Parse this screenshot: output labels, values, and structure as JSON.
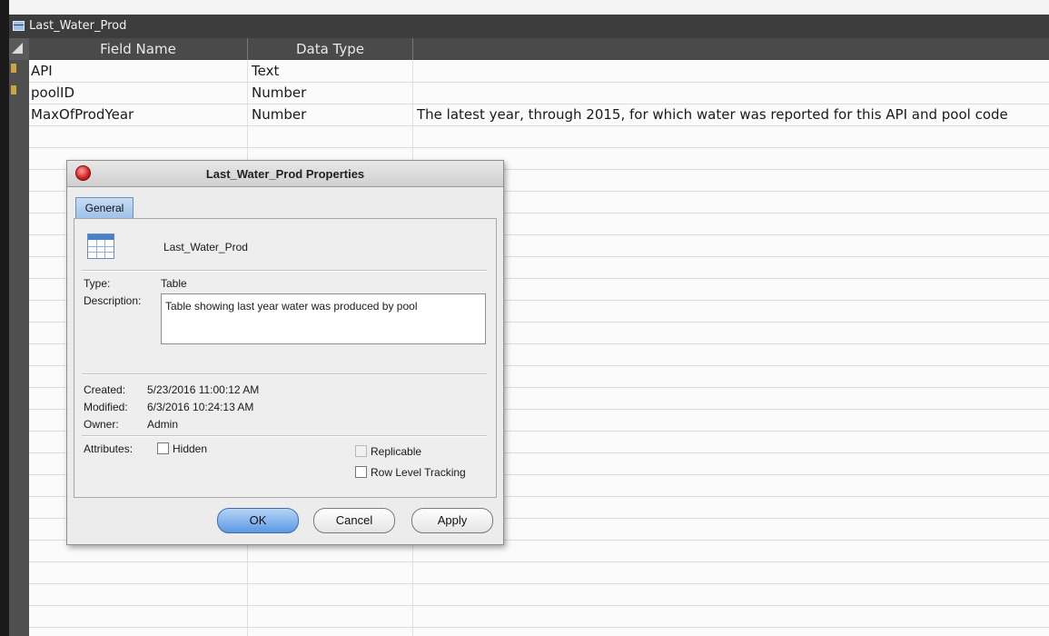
{
  "window": {
    "title": "Last_Water_Prod"
  },
  "columns": {
    "field_name": "Field Name",
    "data_type": "Data Type"
  },
  "rows": [
    {
      "field": "API",
      "type": "Text",
      "description": ""
    },
    {
      "field": "poolID",
      "type": "Number",
      "description": ""
    },
    {
      "field": "MaxOfProdYear",
      "type": "Number",
      "description": "The latest year, through 2015, for which water was reported for this API and pool code"
    }
  ],
  "dialog": {
    "title": "Last_Water_Prod Properties",
    "tab": "General",
    "object_name": "Last_Water_Prod",
    "type_label": "Type:",
    "type_value": "Table",
    "description_label": "Description:",
    "description_value": "Table showing last year water was produced by pool",
    "created_label": "Created:",
    "created_value": "5/23/2016 11:00:12 AM",
    "modified_label": "Modified:",
    "modified_value": "6/3/2016 10:24:13 AM",
    "owner_label": "Owner:",
    "owner_value": "Admin",
    "attributes_label": "Attributes:",
    "hidden_label": "Hidden",
    "replicable_label": "Replicable",
    "row_level_label": "Row Level Tracking",
    "ok_label": "OK",
    "cancel_label": "Cancel",
    "apply_label": "Apply"
  },
  "icons": [
    "table-icon",
    "close-icon",
    "key-icon",
    "select-all-icon"
  ]
}
